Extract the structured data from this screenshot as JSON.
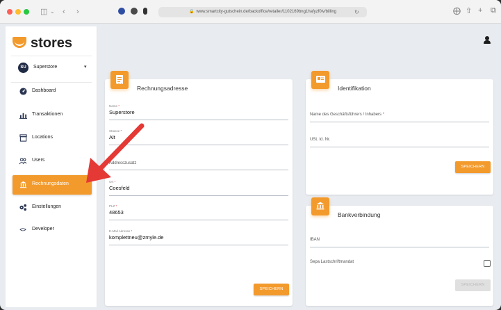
{
  "browser": {
    "url": "www.smartcity-gutschein.de/backoffice/retailer/1102169bng1hafyzf0iv/billing"
  },
  "sidebar": {
    "logo_text": "stores",
    "store": {
      "initials": "SU",
      "name": "Superstore"
    },
    "items": [
      {
        "label": "Dashboard",
        "icon": "dashboard-icon"
      },
      {
        "label": "Transaktionen",
        "icon": "bar-chart-icon"
      },
      {
        "label": "Locations",
        "icon": "store-icon"
      },
      {
        "label": "Users",
        "icon": "users-icon"
      },
      {
        "label": "Rechnungsdaten",
        "icon": "bank-icon",
        "active": true
      },
      {
        "label": "Einstellungen",
        "icon": "gears-icon"
      },
      {
        "label": "Developer",
        "icon": "code-icon"
      }
    ]
  },
  "billing_card": {
    "title": "Rechnungsadresse",
    "fields": {
      "name": {
        "label": "Name",
        "value": "Superstore"
      },
      "strasse": {
        "label": "Strasse",
        "value": "Alt"
      },
      "adresszusatz": {
        "placeholder": "Addresszusatz"
      },
      "ort": {
        "label": "Ort",
        "value": "Coesfeld"
      },
      "plz": {
        "label": "PLZ",
        "value": "48653"
      },
      "email": {
        "label": "E-Mail Adresse",
        "value": "komplettneu@zmyle.de"
      }
    },
    "required_mark": "*",
    "save_label": "SPEICHERN"
  },
  "id_card": {
    "title": "Identifikation",
    "fields": {
      "inhaber": {
        "placeholder": "Name des Geschäftsführers / Inhabers"
      },
      "ust": {
        "placeholder": "USt. Id. Nr."
      }
    },
    "required_mark": "*",
    "save_label": "SPEICHERN"
  },
  "bank_card": {
    "title": "Bankverbindung",
    "fields": {
      "iban": {
        "placeholder": "IBAN"
      },
      "sepa": {
        "label": "Sepa Lastschriftmandat",
        "checked": false
      }
    },
    "save_label": "SPEICHERN",
    "save_disabled": true
  },
  "colors": {
    "accent": "#f39a2c",
    "arrow": "#e53935",
    "navy": "#1f2a44"
  }
}
